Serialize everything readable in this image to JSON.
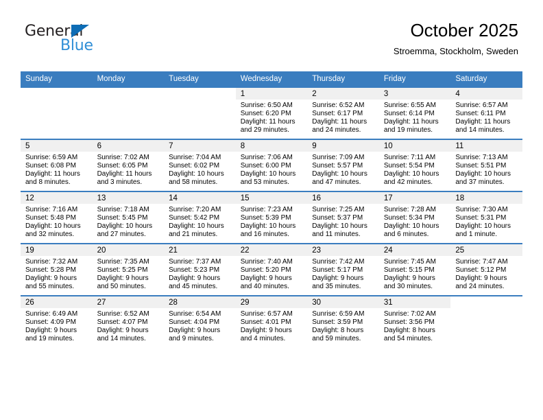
{
  "brand": {
    "name_part1": "General",
    "name_part2": "Blue",
    "triangle_color": "#0d6cb5",
    "blue_color": "#2f8ed6"
  },
  "header": {
    "month_title": "October 2025",
    "location": "Stroemma, Stockholm, Sweden"
  },
  "theme": {
    "header_blue": "#3a7dbf",
    "daynum_band": "#f0f0f0"
  },
  "weekday_headers": [
    "Sunday",
    "Monday",
    "Tuesday",
    "Wednesday",
    "Thursday",
    "Friday",
    "Saturday"
  ],
  "labels": {
    "sunrise_prefix": "Sunrise:",
    "sunset_prefix": "Sunset:",
    "daylight_prefix": "Daylight:"
  },
  "weeks": [
    [
      {
        "day": "",
        "sunrise": "",
        "sunset": "",
        "daylight_line1": "",
        "daylight_line2": "",
        "empty": true
      },
      {
        "day": "",
        "sunrise": "",
        "sunset": "",
        "daylight_line1": "",
        "daylight_line2": "",
        "empty": true
      },
      {
        "day": "",
        "sunrise": "",
        "sunset": "",
        "daylight_line1": "",
        "daylight_line2": "",
        "empty": true
      },
      {
        "day": "1",
        "sunrise": "Sunrise: 6:50 AM",
        "sunset": "Sunset: 6:20 PM",
        "daylight_line1": "Daylight: 11 hours",
        "daylight_line2": "and 29 minutes.",
        "empty": false
      },
      {
        "day": "2",
        "sunrise": "Sunrise: 6:52 AM",
        "sunset": "Sunset: 6:17 PM",
        "daylight_line1": "Daylight: 11 hours",
        "daylight_line2": "and 24 minutes.",
        "empty": false
      },
      {
        "day": "3",
        "sunrise": "Sunrise: 6:55 AM",
        "sunset": "Sunset: 6:14 PM",
        "daylight_line1": "Daylight: 11 hours",
        "daylight_line2": "and 19 minutes.",
        "empty": false
      },
      {
        "day": "4",
        "sunrise": "Sunrise: 6:57 AM",
        "sunset": "Sunset: 6:11 PM",
        "daylight_line1": "Daylight: 11 hours",
        "daylight_line2": "and 14 minutes.",
        "empty": false
      }
    ],
    [
      {
        "day": "5",
        "sunrise": "Sunrise: 6:59 AM",
        "sunset": "Sunset: 6:08 PM",
        "daylight_line1": "Daylight: 11 hours",
        "daylight_line2": "and 8 minutes.",
        "empty": false
      },
      {
        "day": "6",
        "sunrise": "Sunrise: 7:02 AM",
        "sunset": "Sunset: 6:05 PM",
        "daylight_line1": "Daylight: 11 hours",
        "daylight_line2": "and 3 minutes.",
        "empty": false
      },
      {
        "day": "7",
        "sunrise": "Sunrise: 7:04 AM",
        "sunset": "Sunset: 6:02 PM",
        "daylight_line1": "Daylight: 10 hours",
        "daylight_line2": "and 58 minutes.",
        "empty": false
      },
      {
        "day": "8",
        "sunrise": "Sunrise: 7:06 AM",
        "sunset": "Sunset: 6:00 PM",
        "daylight_line1": "Daylight: 10 hours",
        "daylight_line2": "and 53 minutes.",
        "empty": false
      },
      {
        "day": "9",
        "sunrise": "Sunrise: 7:09 AM",
        "sunset": "Sunset: 5:57 PM",
        "daylight_line1": "Daylight: 10 hours",
        "daylight_line2": "and 47 minutes.",
        "empty": false
      },
      {
        "day": "10",
        "sunrise": "Sunrise: 7:11 AM",
        "sunset": "Sunset: 5:54 PM",
        "daylight_line1": "Daylight: 10 hours",
        "daylight_line2": "and 42 minutes.",
        "empty": false
      },
      {
        "day": "11",
        "sunrise": "Sunrise: 7:13 AM",
        "sunset": "Sunset: 5:51 PM",
        "daylight_line1": "Daylight: 10 hours",
        "daylight_line2": "and 37 minutes.",
        "empty": false
      }
    ],
    [
      {
        "day": "12",
        "sunrise": "Sunrise: 7:16 AM",
        "sunset": "Sunset: 5:48 PM",
        "daylight_line1": "Daylight: 10 hours",
        "daylight_line2": "and 32 minutes.",
        "empty": false
      },
      {
        "day": "13",
        "sunrise": "Sunrise: 7:18 AM",
        "sunset": "Sunset: 5:45 PM",
        "daylight_line1": "Daylight: 10 hours",
        "daylight_line2": "and 27 minutes.",
        "empty": false
      },
      {
        "day": "14",
        "sunrise": "Sunrise: 7:20 AM",
        "sunset": "Sunset: 5:42 PM",
        "daylight_line1": "Daylight: 10 hours",
        "daylight_line2": "and 21 minutes.",
        "empty": false
      },
      {
        "day": "15",
        "sunrise": "Sunrise: 7:23 AM",
        "sunset": "Sunset: 5:39 PM",
        "daylight_line1": "Daylight: 10 hours",
        "daylight_line2": "and 16 minutes.",
        "empty": false
      },
      {
        "day": "16",
        "sunrise": "Sunrise: 7:25 AM",
        "sunset": "Sunset: 5:37 PM",
        "daylight_line1": "Daylight: 10 hours",
        "daylight_line2": "and 11 minutes.",
        "empty": false
      },
      {
        "day": "17",
        "sunrise": "Sunrise: 7:28 AM",
        "sunset": "Sunset: 5:34 PM",
        "daylight_line1": "Daylight: 10 hours",
        "daylight_line2": "and 6 minutes.",
        "empty": false
      },
      {
        "day": "18",
        "sunrise": "Sunrise: 7:30 AM",
        "sunset": "Sunset: 5:31 PM",
        "daylight_line1": "Daylight: 10 hours",
        "daylight_line2": "and 1 minute.",
        "empty": false
      }
    ],
    [
      {
        "day": "19",
        "sunrise": "Sunrise: 7:32 AM",
        "sunset": "Sunset: 5:28 PM",
        "daylight_line1": "Daylight: 9 hours",
        "daylight_line2": "and 55 minutes.",
        "empty": false
      },
      {
        "day": "20",
        "sunrise": "Sunrise: 7:35 AM",
        "sunset": "Sunset: 5:25 PM",
        "daylight_line1": "Daylight: 9 hours",
        "daylight_line2": "and 50 minutes.",
        "empty": false
      },
      {
        "day": "21",
        "sunrise": "Sunrise: 7:37 AM",
        "sunset": "Sunset: 5:23 PM",
        "daylight_line1": "Daylight: 9 hours",
        "daylight_line2": "and 45 minutes.",
        "empty": false
      },
      {
        "day": "22",
        "sunrise": "Sunrise: 7:40 AM",
        "sunset": "Sunset: 5:20 PM",
        "daylight_line1": "Daylight: 9 hours",
        "daylight_line2": "and 40 minutes.",
        "empty": false
      },
      {
        "day": "23",
        "sunrise": "Sunrise: 7:42 AM",
        "sunset": "Sunset: 5:17 PM",
        "daylight_line1": "Daylight: 9 hours",
        "daylight_line2": "and 35 minutes.",
        "empty": false
      },
      {
        "day": "24",
        "sunrise": "Sunrise: 7:45 AM",
        "sunset": "Sunset: 5:15 PM",
        "daylight_line1": "Daylight: 9 hours",
        "daylight_line2": "and 30 minutes.",
        "empty": false
      },
      {
        "day": "25",
        "sunrise": "Sunrise: 7:47 AM",
        "sunset": "Sunset: 5:12 PM",
        "daylight_line1": "Daylight: 9 hours",
        "daylight_line2": "and 24 minutes.",
        "empty": false
      }
    ],
    [
      {
        "day": "26",
        "sunrise": "Sunrise: 6:49 AM",
        "sunset": "Sunset: 4:09 PM",
        "daylight_line1": "Daylight: 9 hours",
        "daylight_line2": "and 19 minutes.",
        "empty": false
      },
      {
        "day": "27",
        "sunrise": "Sunrise: 6:52 AM",
        "sunset": "Sunset: 4:07 PM",
        "daylight_line1": "Daylight: 9 hours",
        "daylight_line2": "and 14 minutes.",
        "empty": false
      },
      {
        "day": "28",
        "sunrise": "Sunrise: 6:54 AM",
        "sunset": "Sunset: 4:04 PM",
        "daylight_line1": "Daylight: 9 hours",
        "daylight_line2": "and 9 minutes.",
        "empty": false
      },
      {
        "day": "29",
        "sunrise": "Sunrise: 6:57 AM",
        "sunset": "Sunset: 4:01 PM",
        "daylight_line1": "Daylight: 9 hours",
        "daylight_line2": "and 4 minutes.",
        "empty": false
      },
      {
        "day": "30",
        "sunrise": "Sunrise: 6:59 AM",
        "sunset": "Sunset: 3:59 PM",
        "daylight_line1": "Daylight: 8 hours",
        "daylight_line2": "and 59 minutes.",
        "empty": false
      },
      {
        "day": "31",
        "sunrise": "Sunrise: 7:02 AM",
        "sunset": "Sunset: 3:56 PM",
        "daylight_line1": "Daylight: 8 hours",
        "daylight_line2": "and 54 minutes.",
        "empty": false
      },
      {
        "day": "",
        "sunrise": "",
        "sunset": "",
        "daylight_line1": "",
        "daylight_line2": "",
        "empty": true
      }
    ]
  ]
}
